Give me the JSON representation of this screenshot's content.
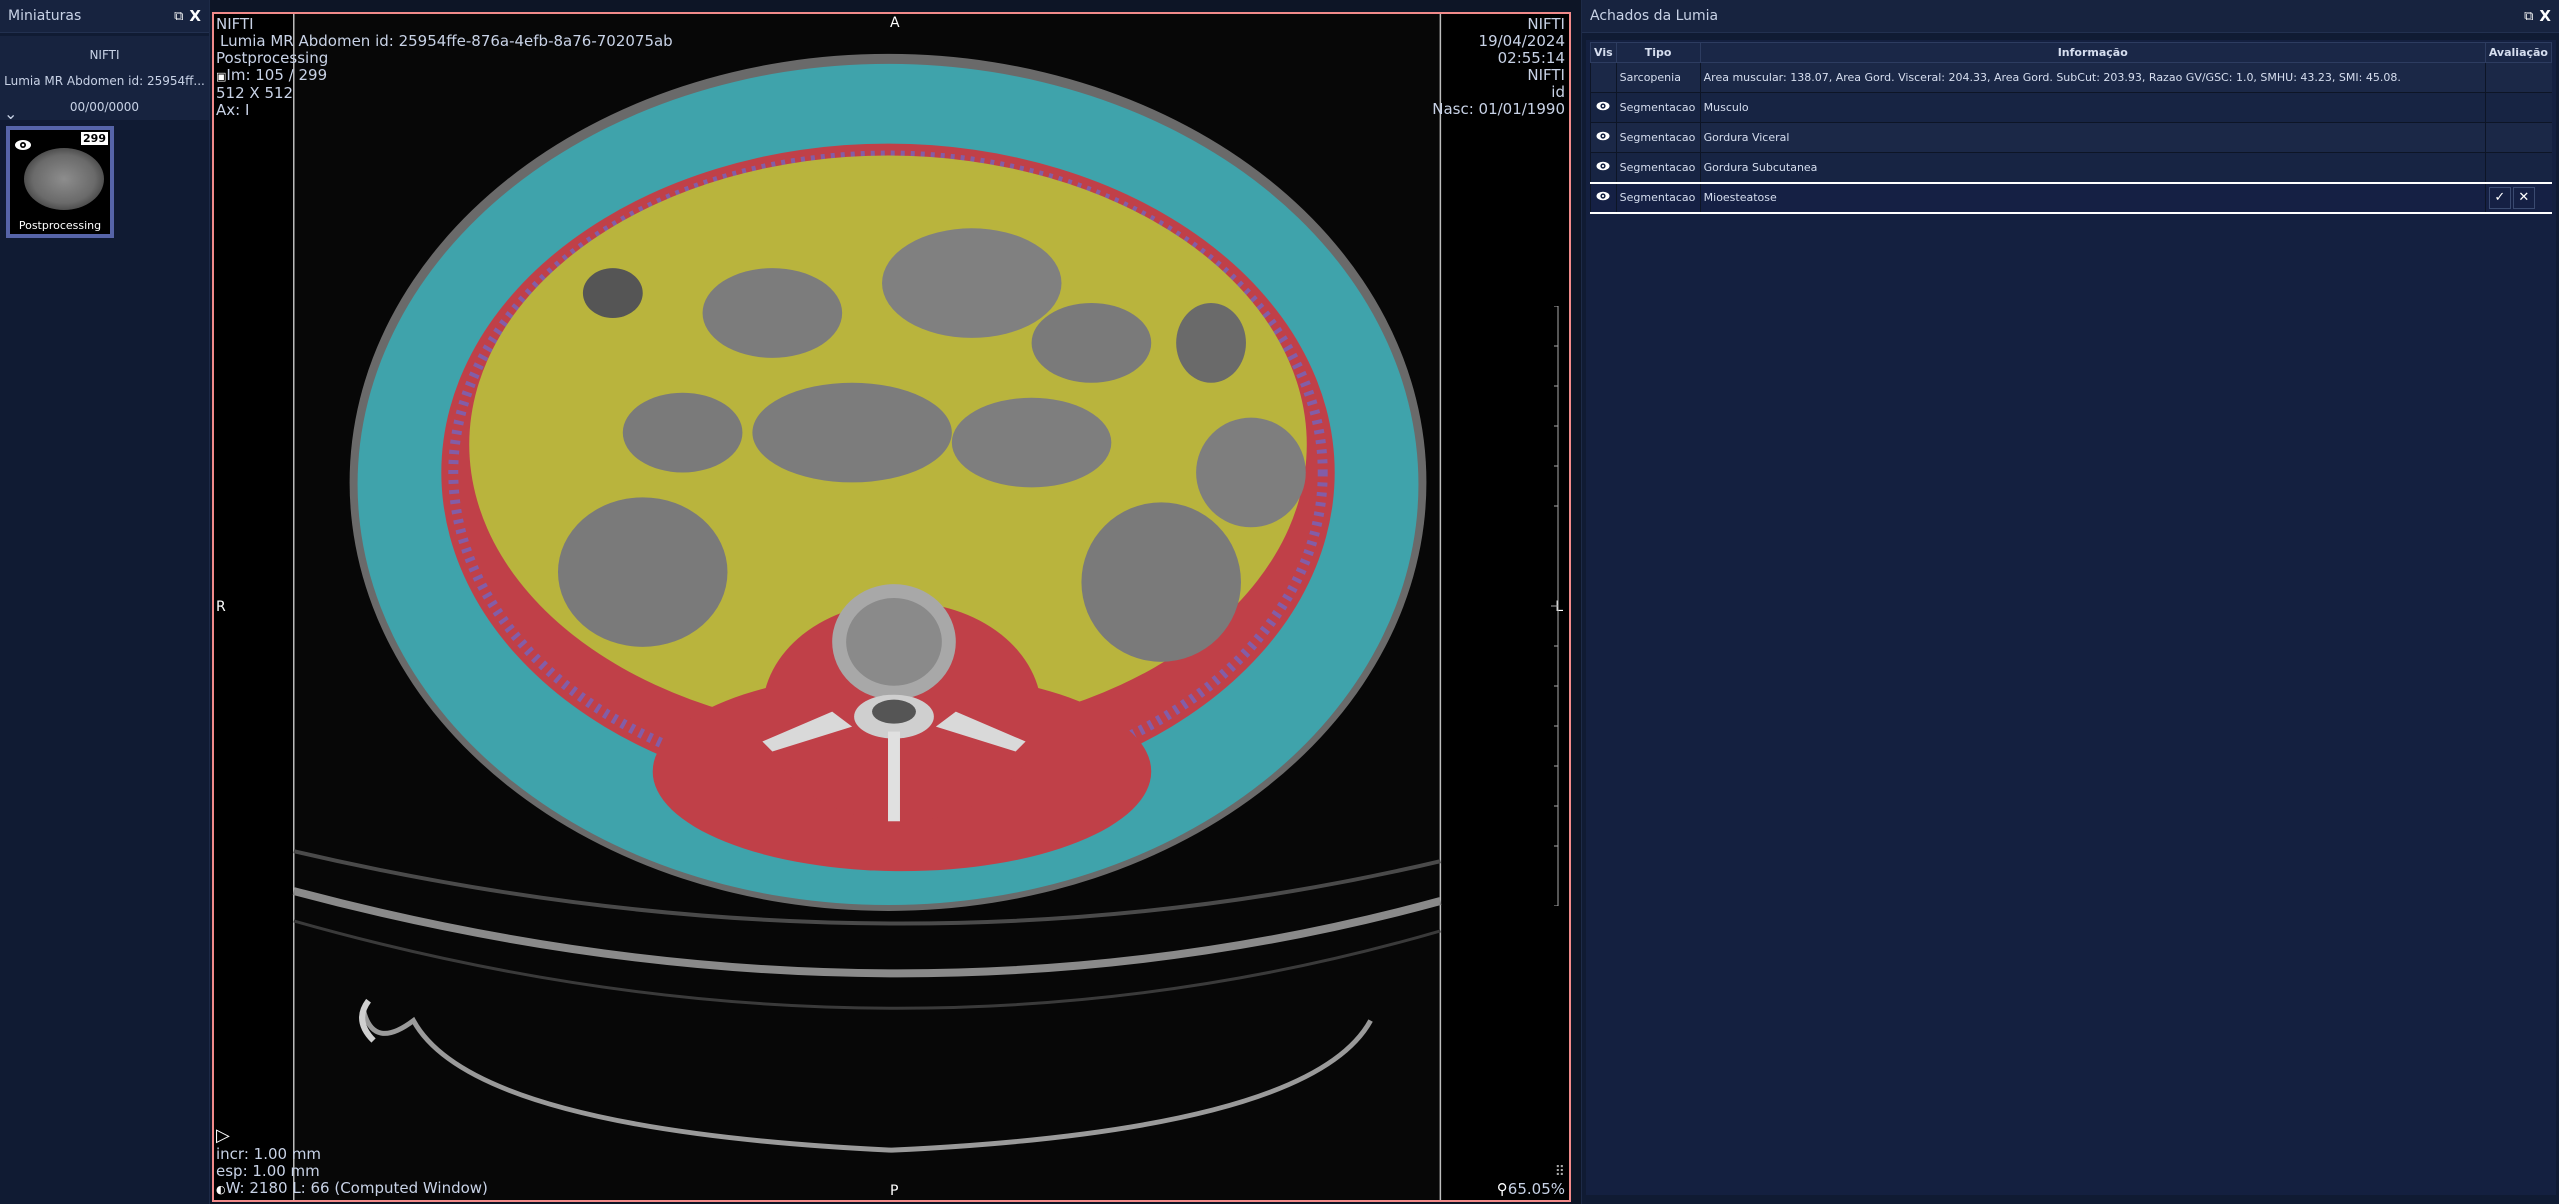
{
  "left_panel": {
    "title": "Miniaturas",
    "series": {
      "modality": "NIFTI",
      "description": "Lumia MR Abdomen id: 25954ff...",
      "date": "00/00/0000"
    },
    "thumbnail": {
      "count": "299",
      "label": "Postprocessing"
    }
  },
  "viewer": {
    "top_left": {
      "modality": "NIFTI",
      "study": "Lumia MR Abdomen id: 25954ffe-876a-4efb-8a76-702075ab",
      "series": "Postprocessing",
      "image": "Im: 105 / 299",
      "matrix": "512 X 512",
      "axis": "Ax: I"
    },
    "top_right": {
      "modality": "NIFTI",
      "date": "19/04/2024",
      "time": "02:55:14",
      "modality2": "NIFTI",
      "id": "id",
      "birth": "Nasc: 01/01/1990"
    },
    "bottom_left": {
      "increment": "incr: 1.00 mm",
      "thickness": "esp: 1.00 mm",
      "window": "W: 2180 L: 66 (Computed Window)"
    },
    "bottom_right": {
      "zoom": "65.05%"
    },
    "orientation": {
      "top": "A",
      "bottom": "P",
      "left": "R",
      "right": "L"
    }
  },
  "right_panel": {
    "title": "Achados da Lumia",
    "columns": [
      "Vis",
      "Tipo",
      "Informação",
      "Avaliação"
    ],
    "rows": [
      {
        "vis": false,
        "tipo": "Sarcopenia",
        "info": "Area muscular: 138.07, Area Gord. Visceral: 204.33, Area Gord. SubCut: 203.93, Razao GV/GSC: 1.0, SMHU: 43.23, SMI: 45.08."
      },
      {
        "vis": true,
        "tipo": "Segmentacao",
        "info": "Musculo"
      },
      {
        "vis": true,
        "tipo": "Segmentacao",
        "info": "Gordura Viceral"
      },
      {
        "vis": true,
        "tipo": "Segmentacao",
        "info": "Gordura Subcutanea"
      },
      {
        "vis": true,
        "tipo": "Segmentacao",
        "info": "Mioesteatose",
        "active": true
      }
    ]
  },
  "colors": {
    "subcutaneous_fat": "#3fa3ab",
    "visceral_fat": "#b9b43d",
    "muscle": "#c04048",
    "myosteatosis": "#6a6ad0",
    "viewer_border": "#f08a8a"
  }
}
